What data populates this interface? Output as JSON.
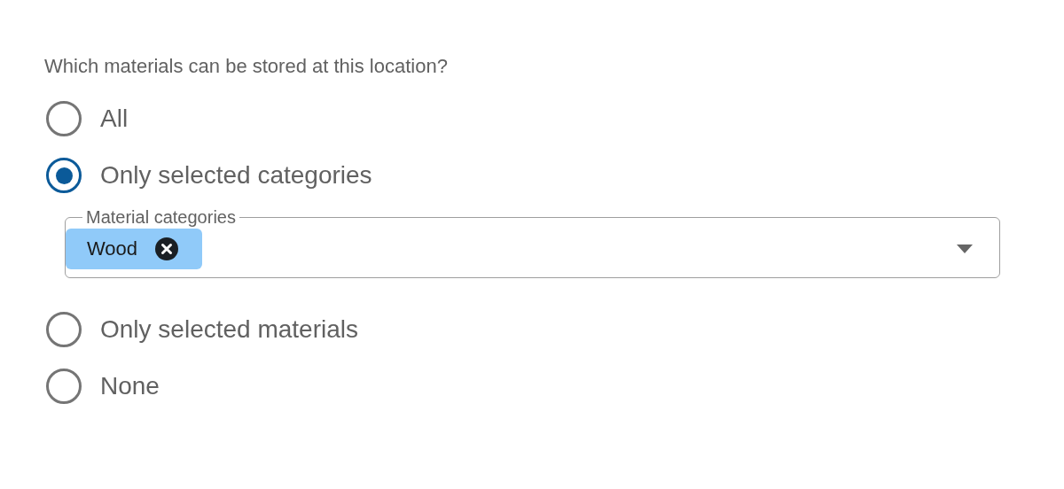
{
  "question": "Which materials can be stored at this location?",
  "options": [
    {
      "label": "All",
      "selected": false
    },
    {
      "label": "Only selected categories",
      "selected": true,
      "field": {
        "label": "Material categories",
        "chips": [
          {
            "label": "Wood"
          }
        ]
      }
    },
    {
      "label": "Only selected materials",
      "selected": false
    },
    {
      "label": "None",
      "selected": false
    }
  ]
}
